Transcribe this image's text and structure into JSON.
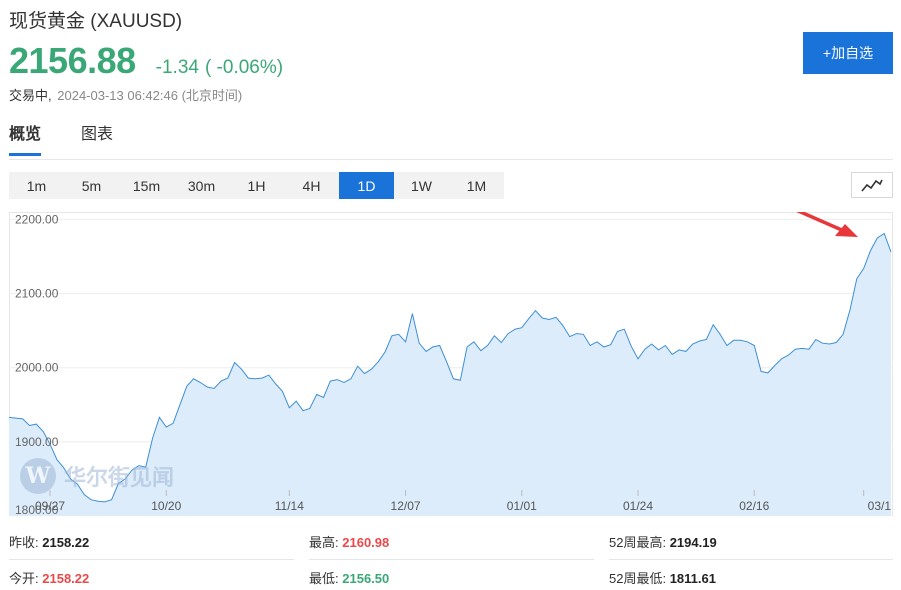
{
  "header": {
    "name": "现货黄金",
    "symbol": "(XAUUSD)",
    "price": "2156.88",
    "change": "-1.34",
    "change_pct": "( -0.06%)",
    "status": "交易中,",
    "timestamp": "2024-03-13 06:42:46 (北京时间)",
    "add_watchlist_label": "+加自选"
  },
  "tabs": [
    {
      "label": "概览"
    },
    {
      "label": "图表"
    }
  ],
  "periods": [
    {
      "label": "1m"
    },
    {
      "label": "5m"
    },
    {
      "label": "15m"
    },
    {
      "label": "30m"
    },
    {
      "label": "1H"
    },
    {
      "label": "4H"
    },
    {
      "label": "1D"
    },
    {
      "label": "1W"
    },
    {
      "label": "1M"
    }
  ],
  "active_period": "1D",
  "watermark": {
    "logo_letter": "W",
    "text": "华尔街见闻"
  },
  "stats": {
    "prev_close_label": "昨收:",
    "prev_close": "2158.22",
    "open_label": "今开:",
    "open": "2158.22",
    "high_label": "最高:",
    "high": "2160.98",
    "low_label": "最低:",
    "low": "2156.50",
    "w52_high_label": "52周最高:",
    "w52_high": "2194.19",
    "w52_low_label": "52周最低:",
    "w52_low": "1811.61"
  },
  "colors": {
    "up": "#e84a4a",
    "down": "#3aa876",
    "accent": "#1a73d9",
    "line": "#3d8fd6",
    "fill": "#dcecfb",
    "arrow": "#e8373a"
  },
  "chart_data": {
    "type": "area",
    "ylim": [
      1800,
      2210
    ],
    "y_ticks": [
      "2200.00",
      "2100.00",
      "2000.00",
      "1900.00",
      "1800.00"
    ],
    "y_tick_values": [
      2200,
      2100,
      2000,
      1900,
      1800
    ],
    "x_ticks": [
      {
        "label": "09/27",
        "index": 6
      },
      {
        "label": "10/20",
        "index": 23
      },
      {
        "label": "11/14",
        "index": 41
      },
      {
        "label": "12/07",
        "index": 58
      },
      {
        "label": "01/01",
        "index": 75
      },
      {
        "label": "01/24",
        "index": 92
      },
      {
        "label": "02/16",
        "index": 109
      },
      {
        "label": "03/1",
        "index": 125
      }
    ],
    "values": [
      1933,
      1932,
      1931,
      1922,
      1924,
      1914,
      1897,
      1876,
      1865,
      1850,
      1843,
      1829,
      1822,
      1820,
      1819,
      1822,
      1844,
      1850,
      1862,
      1868,
      1866,
      1905,
      1933,
      1920,
      1925,
      1950,
      1975,
      1985,
      1980,
      1974,
      1972,
      1982,
      1986,
      2007,
      1998,
      1986,
      1985,
      1986,
      1990,
      1978,
      1968,
      1946,
      1955,
      1942,
      1945,
      1964,
      1960,
      1982,
      1984,
      1980,
      1985,
      2002,
      1992,
      1998,
      2008,
      2021,
      2043,
      2045,
      2035,
      2073,
      2033,
      2022,
      2028,
      2030,
      2008,
      1985,
      1983,
      2028,
      2035,
      2023,
      2030,
      2043,
      2034,
      2046,
      2052,
      2054,
      2066,
      2077,
      2067,
      2065,
      2068,
      2057,
      2042,
      2046,
      2045,
      2030,
      2035,
      2028,
      2031,
      2049,
      2052,
      2029,
      2012,
      2025,
      2032,
      2024,
      2030,
      2018,
      2024,
      2022,
      2032,
      2036,
      2038,
      2058,
      2045,
      2030,
      2037,
      2037,
      2035,
      2030,
      1995,
      1993,
      2003,
      2012,
      2017,
      2025,
      2026,
      2025,
      2038,
      2033,
      2032,
      2034,
      2045,
      2078,
      2120,
      2134,
      2158,
      2175,
      2181,
      2156
    ]
  }
}
